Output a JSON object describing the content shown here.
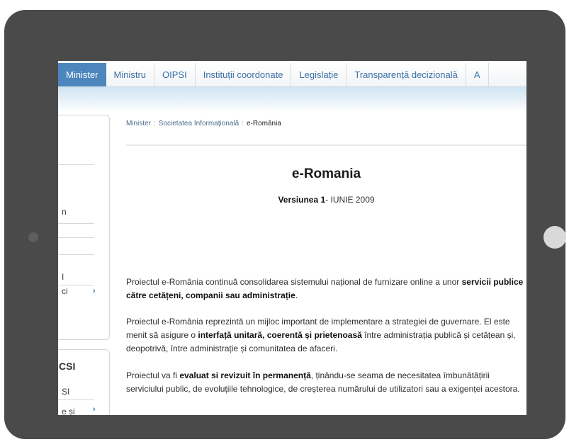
{
  "nav": {
    "items": [
      {
        "label": "Minister",
        "active": true
      },
      {
        "label": "Ministru",
        "active": false
      },
      {
        "label": "OIPSI",
        "active": false
      },
      {
        "label": "Instituții coordonate",
        "active": false
      },
      {
        "label": "Legislație",
        "active": false
      },
      {
        "label": "Transparență decizională",
        "active": false
      },
      {
        "label": "A",
        "active": false
      }
    ]
  },
  "sidebar": {
    "box1": {
      "items": [
        "n",
        "I",
        "ci"
      ],
      "arrow": "›"
    },
    "box2": {
      "heading": "CSI",
      "items": [
        "SI",
        "e și"
      ],
      "arrow": "›"
    }
  },
  "breadcrumb": {
    "items": [
      "Minister",
      "Societatea Informațională",
      "e-România"
    ],
    "separator": ":"
  },
  "page": {
    "title": "e-Romania",
    "version_bold": "Versiunea 1",
    "version_rest": "- IUNIE 2009"
  },
  "paragraphs": {
    "p1_a": "Proiectul e-România continuă consolidarea sistemului național de furnizare online a unor ",
    "p1_b": "servicii publice către cetățeni, companii sau administrație",
    "p1_c": ".",
    "p2_a": "Proiectul e-România reprezintă un mijloc important de implementare a strategiei de guvernare. El este menit să asigure o ",
    "p2_b": "interfață unitară, coerentă și prietenoasă",
    "p2_c": " între administrația publică și cetățean și, deopotrivă, între administrație și comunitatea de afaceri.",
    "p3_a": "Proiectul va fi ",
    "p3_b": "evaluat si revizuit în permanență",
    "p3_c": ", ținându-se seama de necesitatea îmbunătățirii serviciului public, de evoluțiile tehnologice, de creșterea numărului de utilizatori sau a exigenței acestora."
  },
  "colors": {
    "frame": "#4a4a4a",
    "nav_active": "#4c86bd",
    "link": "#3a6fa8"
  }
}
